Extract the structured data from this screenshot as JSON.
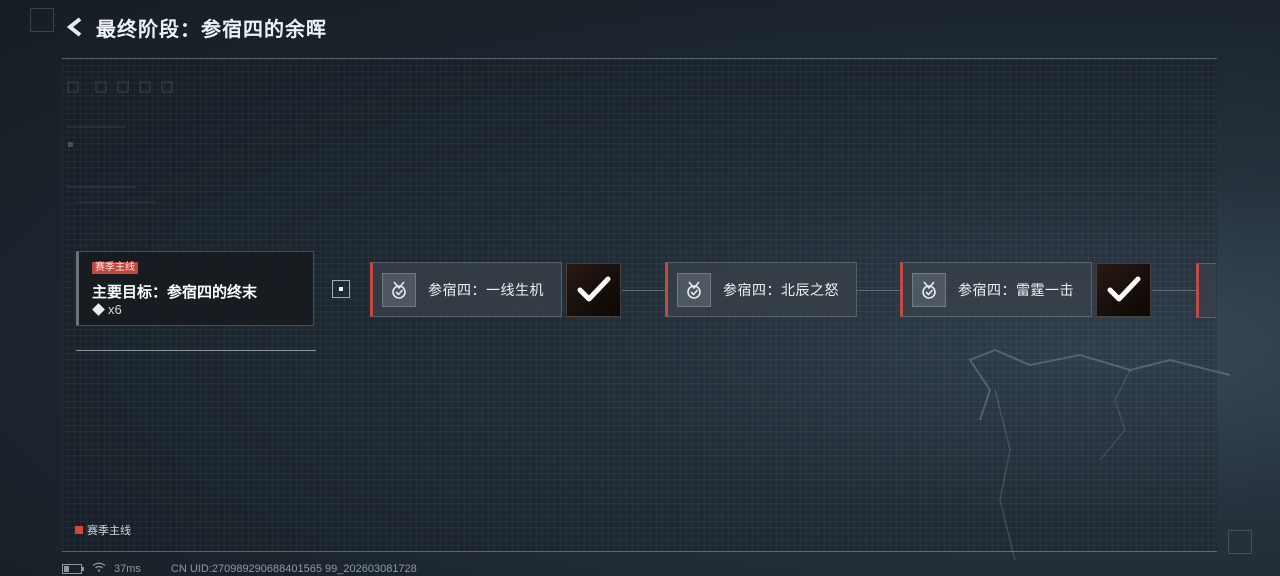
{
  "header": {
    "title": "最终阶段：参宿四的余晖",
    "back_icon": "chevron-left-icon"
  },
  "goal": {
    "tag": "赛季主线",
    "title": "主要目标：参宿四的终末",
    "reward_icon": "diamond-icon",
    "reward": "x6"
  },
  "tasks": [
    {
      "label": "参宿四：一线生机",
      "icon": "medal-icon",
      "completed": true
    },
    {
      "label": "参宿四：北辰之怒",
      "icon": "medal-icon",
      "completed": false
    },
    {
      "label": "参宿四：雷霆一击",
      "icon": "medal-icon",
      "completed": true
    }
  ],
  "legend": {
    "label": "赛季主线",
    "color": "#d9453b"
  },
  "status": {
    "ping": "37ms",
    "uid": "CN UID:270989290688401565 99_202603081728"
  },
  "colors": {
    "accent": "#c24a42",
    "background": "#1b242c"
  }
}
